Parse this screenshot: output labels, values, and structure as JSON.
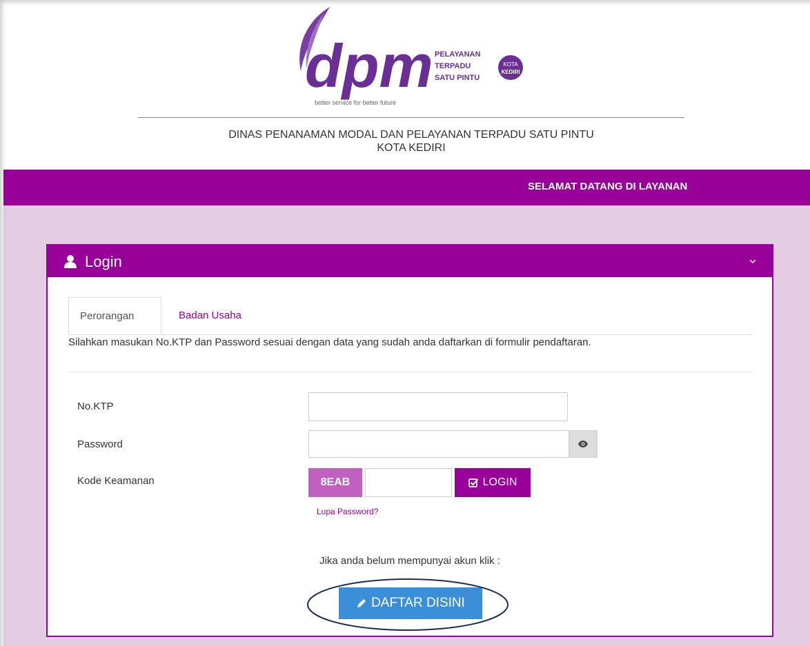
{
  "header": {
    "logo_text": "dpm",
    "logo_service_lines": [
      "PELAYANAN",
      "TERPADU",
      "SATU PINTU"
    ],
    "logo_badge_lines": [
      "KOTA",
      "KEDIRI"
    ],
    "tagline": "better service for better future",
    "org_name_line1": "DINAS PENANAMAN MODAL DAN PELAYANAN TERPADU SATU PINTU",
    "org_name_line2": "KOTA KEDIRI"
  },
  "topbar": {
    "marquee": "SELAMAT DATANG DI LAYANAN"
  },
  "panel": {
    "title": "Login",
    "tabs": [
      {
        "label": "Perorangan",
        "active": true
      },
      {
        "label": "Badan Usaha",
        "active": false
      }
    ],
    "instructions": "Silahkan masukan No.KTP dan Password sesuai dengan data yang sudah anda daftarkan di formulir pendaftaran.",
    "fields": {
      "ktp_label": "No.KTP",
      "ktp_value": "",
      "password_label": "Password",
      "password_value": "",
      "security_label": "Kode Keamanan",
      "captcha_code": "8EAB",
      "security_value": ""
    },
    "login_label": "LOGIN",
    "forgot_label": "Lupa Password?",
    "no_account_text": "Jika anda belum mempunyai akun klik :",
    "register_label": "DAFTAR DISINI"
  },
  "colors": {
    "brand_purple": "#990099",
    "content_bg": "#e4cde4",
    "captcha_bg": "#c060c0",
    "register_blue": "#3a8fd8",
    "annotation_navy": "#1a2a5e"
  }
}
